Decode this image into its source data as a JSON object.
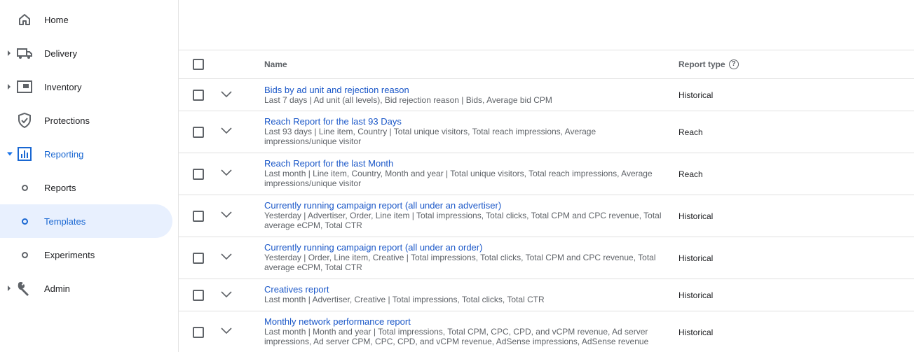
{
  "sidebar": {
    "items": [
      {
        "label": "Home"
      },
      {
        "label": "Delivery"
      },
      {
        "label": "Inventory"
      },
      {
        "label": "Protections"
      },
      {
        "label": "Reporting"
      },
      {
        "label": "Reports"
      },
      {
        "label": "Templates"
      },
      {
        "label": "Experiments"
      },
      {
        "label": "Admin"
      }
    ]
  },
  "table": {
    "headers": {
      "name": "Name",
      "report_type": "Report type",
      "help_glyph": "?"
    },
    "rows": [
      {
        "title": "Bids by ad unit and rejection reason",
        "desc": "Last 7 days | Ad unit (all levels), Bid rejection reason | Bids, Average bid CPM",
        "type": "Historical"
      },
      {
        "title": "Reach Report for the last 93 Days",
        "desc": "Last 93 days | Line item, Country | Total unique visitors, Total reach impressions, Average impressions/unique visitor",
        "type": "Reach"
      },
      {
        "title": "Reach Report for the last Month",
        "desc": "Last month | Line item, Country, Month and year | Total unique visitors, Total reach impressions, Average impressions/unique visitor",
        "type": "Reach"
      },
      {
        "title": "Currently running campaign report (all under an advertiser)",
        "desc": "Yesterday | Advertiser, Order, Line item | Total impressions, Total clicks, Total CPM and CPC revenue, Total average eCPM, Total CTR",
        "type": "Historical"
      },
      {
        "title": "Currently running campaign report (all under an order)",
        "desc": "Yesterday | Order, Line item, Creative | Total impressions, Total clicks, Total CPM and CPC revenue, Total average eCPM, Total CTR",
        "type": "Historical"
      },
      {
        "title": "Creatives report",
        "desc": "Last month | Advertiser, Creative | Total impressions, Total clicks, Total CTR",
        "type": "Historical"
      },
      {
        "title": "Monthly network performance report",
        "desc": "Last month | Month and year | Total impressions, Total CPM, CPC, CPD, and vCPM revenue, Ad server impressions, Ad server CPM, CPC, CPD, and vCPM revenue, AdSense impressions, AdSense revenue",
        "type": "Historical"
      }
    ]
  },
  "colors": {
    "accent": "#1967d2",
    "link": "#1a57c8",
    "selected_bg": "#e8f0fe"
  }
}
